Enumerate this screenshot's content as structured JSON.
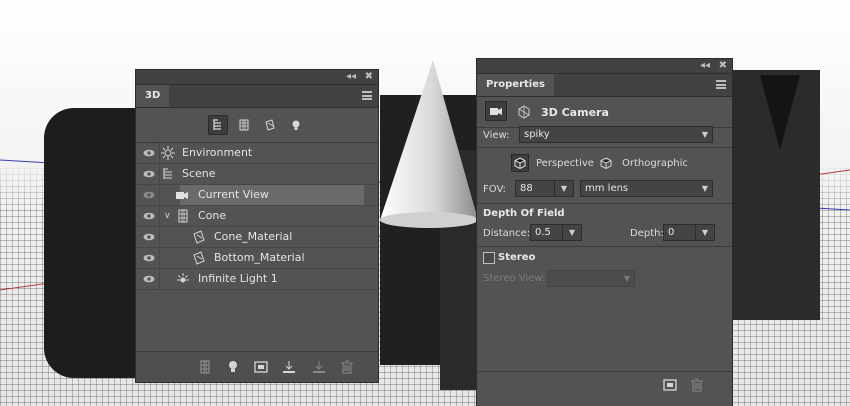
{
  "panel3d": {
    "tab": "3D",
    "collapse": "◂◂",
    "close": "✖",
    "layers": [
      {
        "label": "Environment"
      },
      {
        "label": "Scene"
      },
      {
        "label": "Current View"
      },
      {
        "label": "Cone",
        "expander": "∨"
      },
      {
        "label": "Cone_Material"
      },
      {
        "label": "Bottom_Material"
      },
      {
        "label": "Infinite Light 1"
      }
    ]
  },
  "properties": {
    "tab": "Properties",
    "collapse": "◂◂",
    "close": "✖",
    "title": "3D Camera",
    "view_label": "View:",
    "view_value": "spiky",
    "perspective": "Perspective",
    "orthographic": "Orthographic",
    "fov_label": "FOV:",
    "fov_value": "88",
    "lens_value": "mm lens",
    "dof_heading": "Depth Of Field",
    "distance_label": "Distance:",
    "distance_value": "0.5",
    "depth_label": "Depth:",
    "depth_value": "0",
    "stereo_label": "Stereo",
    "stereo_view_label": "Stereo View:"
  },
  "colors": {
    "panel": "#535353",
    "header": "#424242",
    "selected_row": "#6a6a6a"
  }
}
